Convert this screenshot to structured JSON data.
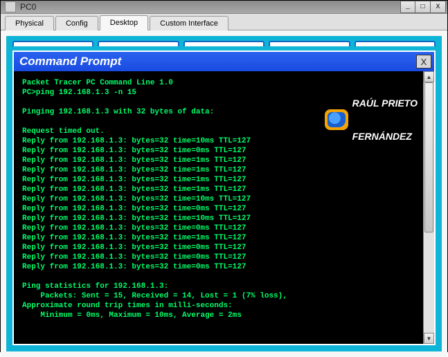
{
  "window": {
    "title": "PC0",
    "buttons": {
      "min": "_",
      "max": "□",
      "close": "X"
    }
  },
  "tabs": [
    {
      "label": "Physical",
      "active": false
    },
    {
      "label": "Config",
      "active": false
    },
    {
      "label": "Desktop",
      "active": true
    },
    {
      "label": "Custom Interface",
      "active": false
    }
  ],
  "command_prompt": {
    "title": "Command Prompt",
    "close_label": "X"
  },
  "watermark": {
    "line1": "RAÚL PRIETO",
    "line2": "FERNÁNDEZ"
  },
  "terminal": {
    "banner": "Packet Tracer PC Command Line 1.0",
    "prompt_line": "PC>ping 192.168.1.3 -n 15",
    "header": "Pinging 192.168.1.3 with 32 bytes of data:",
    "timeout": "Request timed out.",
    "replies": [
      "Reply from 192.168.1.3: bytes=32 time=10ms TTL=127",
      "Reply from 192.168.1.3: bytes=32 time=0ms TTL=127",
      "Reply from 192.168.1.3: bytes=32 time=1ms TTL=127",
      "Reply from 192.168.1.3: bytes=32 time=1ms TTL=127",
      "Reply from 192.168.1.3: bytes=32 time=1ms TTL=127",
      "Reply from 192.168.1.3: bytes=32 time=1ms TTL=127",
      "Reply from 192.168.1.3: bytes=32 time=10ms TTL=127",
      "Reply from 192.168.1.3: bytes=32 time=0ms TTL=127",
      "Reply from 192.168.1.3: bytes=32 time=10ms TTL=127",
      "Reply from 192.168.1.3: bytes=32 time=0ms TTL=127",
      "Reply from 192.168.1.3: bytes=32 time=1ms TTL=127",
      "Reply from 192.168.1.3: bytes=32 time=0ms TTL=127",
      "Reply from 192.168.1.3: bytes=32 time=0ms TTL=127",
      "Reply from 192.168.1.3: bytes=32 time=0ms TTL=127"
    ],
    "stats_header": "Ping statistics for 192.168.1.3:",
    "stats_packets": "    Packets: Sent = 15, Received = 14, Lost = 1 (7% loss),",
    "stats_rtt_header": "Approximate round trip times in milli-seconds:",
    "stats_rtt": "    Minimum = 0ms, Maximum = 10ms, Average = 2ms"
  }
}
